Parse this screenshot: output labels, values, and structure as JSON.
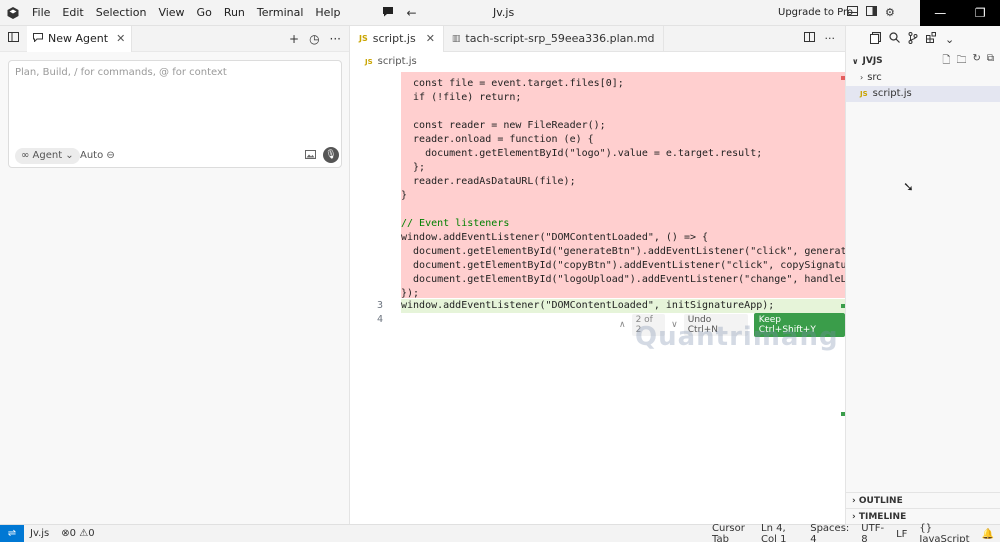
{
  "menu": [
    "File",
    "Edit",
    "Selection",
    "View",
    "Go",
    "Run",
    "Terminal",
    "Help"
  ],
  "window_title": "Jv.js",
  "upgrade_label": "Upgrade to Pro",
  "agent": {
    "tab_label": "New Agent",
    "placeholder": "Plan, Build, / for commands, @ for context",
    "mode_label": "∞ Agent",
    "auto_label": "Auto"
  },
  "editor": {
    "tabs": [
      {
        "label": "script.js",
        "active": true
      },
      {
        "label": "tach-script-srp_59eea336.plan.md",
        "active": false
      }
    ],
    "breadcrumb": "script.js",
    "removed_lines": [
      "  const file = event.target.files[0];",
      "  if (!file) return;",
      "",
      "  const reader = new FileReader();",
      "  reader.onload = function (e) {",
      "    document.getElementById(\"logo\").value = e.target.result;",
      "  };",
      "  reader.readAsDataURL(file);",
      "}",
      "",
      "// Event listeners",
      "window.addEventListener(\"DOMContentLoaded\", () => {",
      "  document.getElementById(\"generateBtn\").addEventListener(\"click\", generateSign",
      "  document.getElementById(\"copyBtn\").addEventListener(\"click\", copySignature);",
      "  document.getElementById(\"logoUpload\").addEventListener(\"change\", handleLogoUp",
      "});"
    ],
    "line3_number": "3",
    "line3_text": "window.addEventListener(\"DOMContentLoaded\", initSignatureApp);",
    "line4_number": "4",
    "diff_count": "2 of 2",
    "undo_label": "Undo Ctrl+N",
    "keep_label": "Keep Ctrl+Shift+Y"
  },
  "watermark": "Quantrimang",
  "explorer": {
    "root": "JVJS",
    "items": [
      {
        "label": "src",
        "type": "folder"
      },
      {
        "label": "script.js",
        "type": "file"
      }
    ],
    "outline_label": "OUTLINE",
    "timeline_label": "TIMELINE"
  },
  "statusbar": {
    "file": "Jv.js",
    "errors": "0",
    "warnings": "0",
    "cursor_tab": "Cursor Tab",
    "position": "Ln 4, Col 1",
    "spaces": "Spaces: 4",
    "encoding": "UTF-8",
    "eol": "LF",
    "language": "JavaScript"
  },
  "colors": {
    "removed_bg": "#ffcfcf",
    "added_bg": "#e6f4d9",
    "keep_button": "#3a9d4a",
    "remote_button": "#0078d4"
  }
}
